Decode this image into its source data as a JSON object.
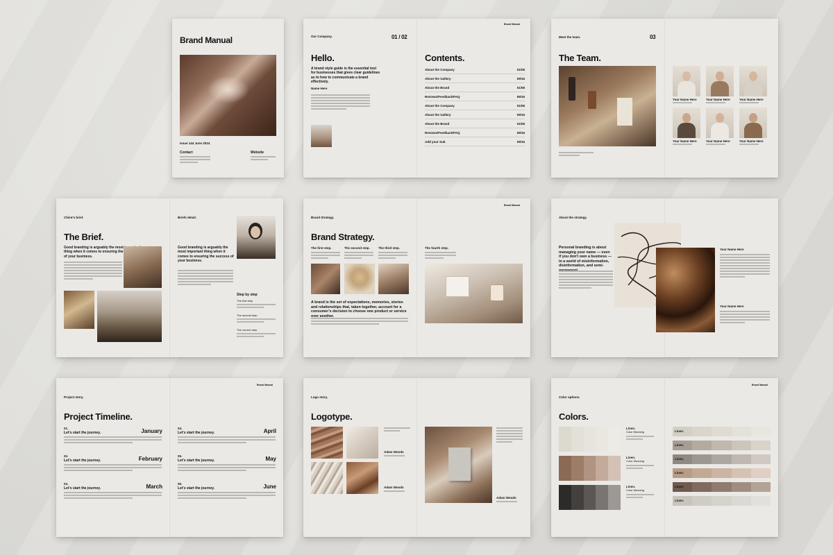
{
  "colors": {
    "background": "#e3e2de",
    "page": "#eae9e6",
    "text": "#111111",
    "accent_brown": "#8b6a55"
  },
  "cover": {
    "title": "Brand Manual",
    "issue": "Issue 144 June 2024",
    "contact_label": "Contact",
    "website_label": "Website"
  },
  "hello": {
    "section_small": "Our Company.",
    "page_indicator": "01 / 02",
    "heading": "Hello.",
    "intro": "A brand style guide is the essential tool for businesses that gives clear guidelines as to how to communicate a brand effectively.",
    "name": "Name Here"
  },
  "contents": {
    "heading": "Contents.",
    "brand_label": "Brand Manual",
    "items": [
      {
        "label": "About the Company",
        "pages": "01/08"
      },
      {
        "label": "About the Gallery",
        "pages": "09/16"
      },
      {
        "label": "About the Brand",
        "pages": "01/08"
      },
      {
        "label": "Reviews/Feedback/FAQ",
        "pages": "09/16"
      },
      {
        "label": "About the Company",
        "pages": "01/08"
      },
      {
        "label": "About the Gallery",
        "pages": "09/16"
      },
      {
        "label": "About the Brand",
        "pages": "01/08"
      },
      {
        "label": "Reviews/Feedback/FAQ",
        "pages": "09/16"
      },
      {
        "label": "Add your Sub",
        "pages": "09/16"
      }
    ]
  },
  "team": {
    "section_small": "Meet the team.",
    "page_number": "03",
    "heading": "The Team.",
    "members": [
      {
        "name": "Your Name Here"
      },
      {
        "name": "Your Name Here"
      },
      {
        "name": "Your Name Here"
      },
      {
        "name": "Your Name Here"
      },
      {
        "name": "Your Name Here"
      },
      {
        "name": "Your Name Here"
      }
    ]
  },
  "brief": {
    "small_label": "Client's brief.",
    "heading": "The Brief.",
    "lead": "Good branding is arguably the most important thing when it comes to ensuring the success of your business.",
    "detail_label": "Briefs detail.",
    "detail_lead": "Good branding is arguably the most important thing when it comes to ensuring the success of your business.",
    "steps_heading": "Step by step",
    "steps": [
      "The first step",
      "The second step",
      "The current step"
    ]
  },
  "strategy": {
    "small_label": "Brand Strategy.",
    "brand_label": "Brand Manual",
    "heading": "Brand Strategy.",
    "steps": [
      "The first step.",
      "The second step.",
      "The third step.",
      "The fourth step."
    ],
    "statement": "A brand is the set of expectations, memories, stories and relationships that, taken together, account for a consumer's decision to choose one product or service over another."
  },
  "about_strategy": {
    "small_label": "About the strategy.",
    "statement": "Personal branding is about managing your name — even if you don't own a business — in a world of misinformation, disinformation, and semi-permanent.",
    "names": [
      "Your Name Here",
      "Your Name Here"
    ]
  },
  "timeline": {
    "small_label": "Project story.",
    "brand_label": "Brand Manual",
    "heading": "Project Timeline.",
    "entries": [
      {
        "num": "01.",
        "title": "Let's start the journey.",
        "month": "January"
      },
      {
        "num": "02.",
        "title": "Let's start the journey.",
        "month": "February"
      },
      {
        "num": "03.",
        "title": "Let's start the journey.",
        "month": "March"
      },
      {
        "num": "04.",
        "title": "Let's start the journey.",
        "month": "April"
      },
      {
        "num": "05.",
        "title": "Let's start the journey.",
        "month": "May"
      },
      {
        "num": "06.",
        "title": "Let's start the journey.",
        "month": "June"
      }
    ]
  },
  "logotype": {
    "small_label": "Logo story.",
    "heading": "Logotype.",
    "names": [
      "Adam Woods",
      "Adam Woods",
      "Adam Woods"
    ]
  },
  "colors_page": {
    "small_label": "Color options.",
    "brand_label": "Brand Manual",
    "heading": "Colors.",
    "swatch_label": "Linen.",
    "swatch_sub": "Color Meaning"
  }
}
